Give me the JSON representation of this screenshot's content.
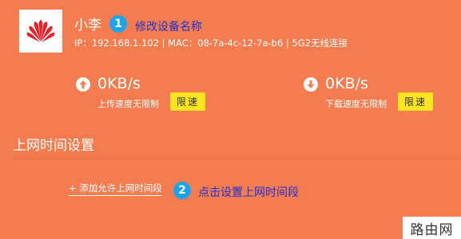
{
  "device": {
    "logo": "huawei-logo",
    "name": "小李",
    "info": "IP：192.168.1.102 | MAC：08-7a-4c-12-7a-b6 | 5G2无线连接"
  },
  "annotations": {
    "step1_number": "1",
    "step1_text": "修改设备名称",
    "step2_number": "2",
    "step2_text": "点击设置上网时间段"
  },
  "upload": {
    "icon": "arrow-up-icon",
    "value": "0KB/s",
    "caption": "上传速度无限制",
    "button_label": "限速"
  },
  "download": {
    "icon": "arrow-down-icon",
    "value": "0KB/s",
    "caption": "下载速度无限制",
    "button_label": "限速"
  },
  "online_time": {
    "section_title": "上网时间设置",
    "add_link": "+ 添加允许上网时间段"
  },
  "watermark": "路由网",
  "colors": {
    "background": "#f47c4f",
    "annotation_badge": "#1aa3ee",
    "annotation_text": "#1f2fd4",
    "limit_button": "#ffe51f",
    "logo_red": "#e8202a"
  }
}
